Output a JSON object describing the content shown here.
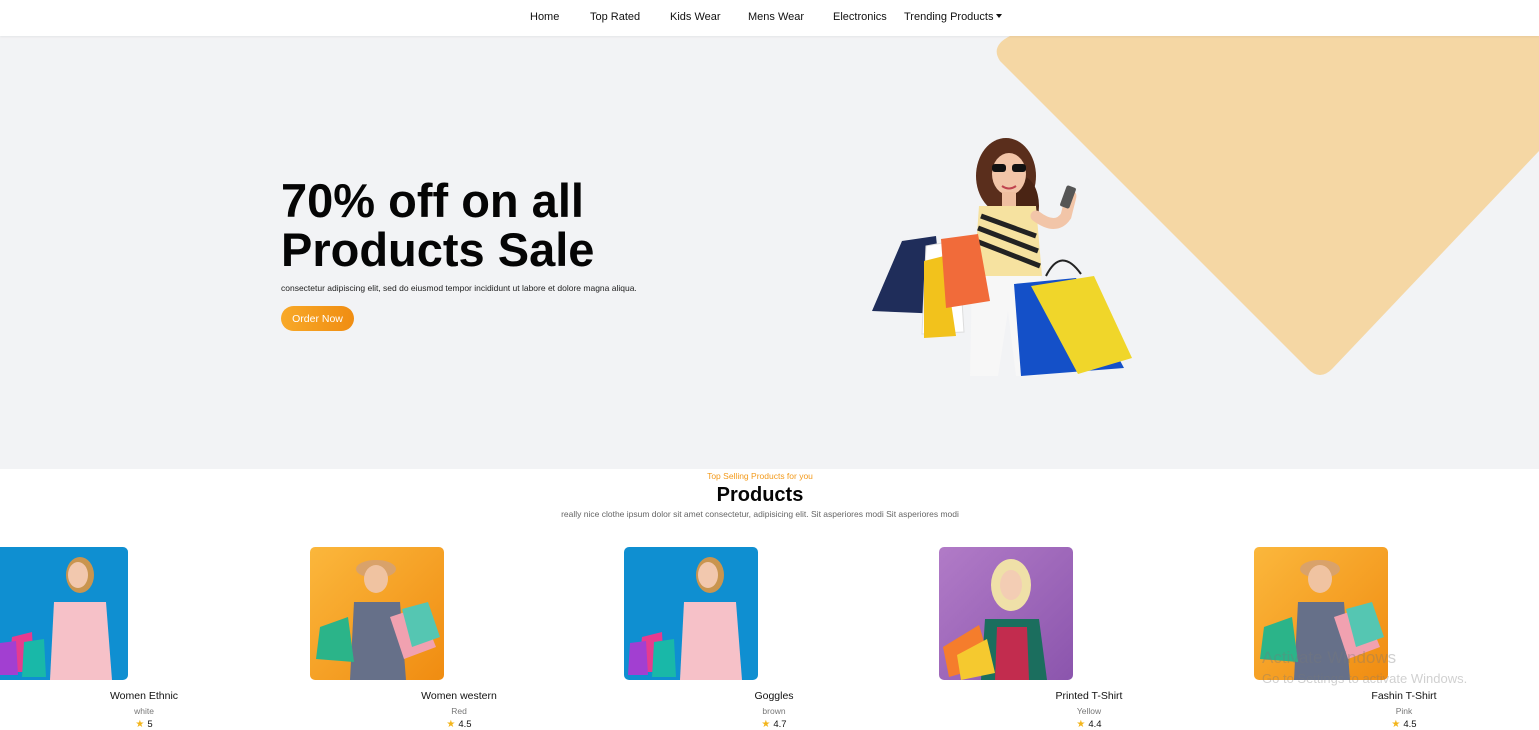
{
  "nav": {
    "items": [
      {
        "label": "Home"
      },
      {
        "label": "Top Rated"
      },
      {
        "label": "Kids Wear"
      },
      {
        "label": "Mens Wear"
      },
      {
        "label": "Electronics"
      },
      {
        "label": "Trending Products"
      }
    ]
  },
  "hero": {
    "title": "70% off on all Products Sale",
    "subtitle": "consectetur adipiscing elit, sed do eiusmod tempor incididunt ut labore et dolore magna aliqua.",
    "button_label": "Order Now",
    "accent_color": "#f39a1b",
    "shape_color": "#f5d7a4"
  },
  "products_section": {
    "eyebrow": "Top Selling Products for you",
    "title": "Products",
    "subtitle": "really nice clothe ipsum dolor sit amet consectetur, adipisicing elit. Sit asperiores modi Sit asperiores modi"
  },
  "products": [
    {
      "name": "Women Ethnic",
      "color": "white",
      "rating": "5",
      "bg": "blue"
    },
    {
      "name": "Women western",
      "color": "Red",
      "rating": "4.5",
      "bg": "orange"
    },
    {
      "name": "Goggles",
      "color": "brown",
      "rating": "4.7",
      "bg": "blue"
    },
    {
      "name": "Printed T-Shirt",
      "color": "Yellow",
      "rating": "4.4",
      "bg": "purple"
    },
    {
      "name": "Fashin T-Shirt",
      "color": "Pink",
      "rating": "4.5",
      "bg": "orange"
    }
  ],
  "watermark": {
    "line1": "Activate Windows",
    "line2": "Go to Settings to activate Windows."
  }
}
